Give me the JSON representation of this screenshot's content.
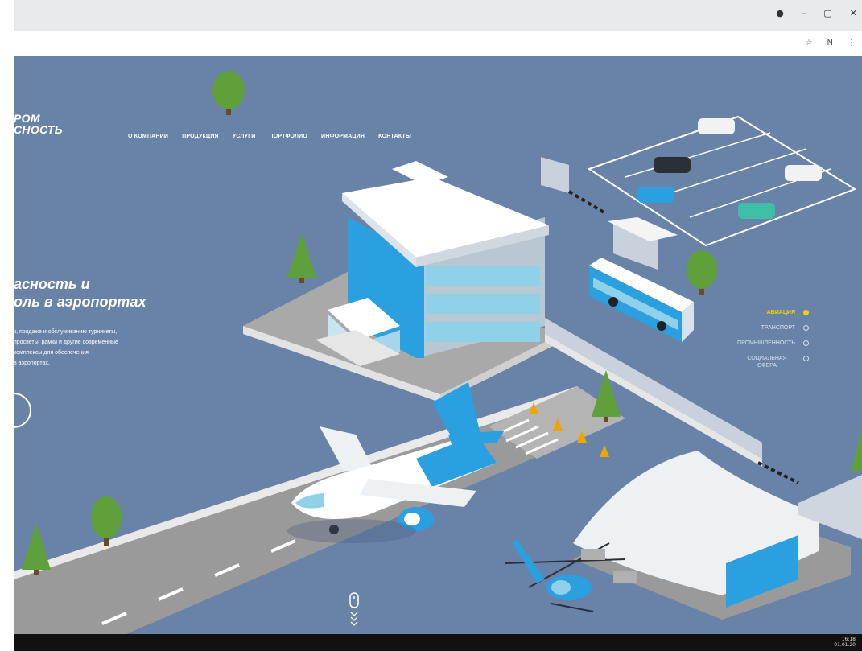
{
  "window": {
    "controls": [
      "●",
      "–",
      "▢",
      "✕"
    ],
    "addr_icons": [
      "☆",
      "N",
      "⋮"
    ]
  },
  "site": {
    "logo": [
      "РОМ",
      "СНОСТЬ"
    ],
    "nav": [
      "О компании",
      "Продукция",
      "Услуги",
      "Портфолио",
      "Информация",
      "Контакты"
    ],
    "hero": {
      "title": [
        "асность и",
        "оль в аэропортах"
      ],
      "desc": [
        "к, продаже и обслуживанию турникеты,",
        "просветы, рамки и другие современные",
        "комплексы для обеспечения",
        "в аэропортах."
      ]
    },
    "side_menu": [
      {
        "label": "Авиация",
        "active": true
      },
      {
        "label": "Транспорт",
        "active": false
      },
      {
        "label": "Промышленность",
        "active": false
      },
      {
        "label": "Социальная сфера",
        "active": false
      }
    ]
  },
  "taskbar": {
    "time": "16:18",
    "date": "01.01.20"
  },
  "colors": {
    "background": "#6983a8",
    "accent": "#f5d000",
    "brand_blue": "#2aa0e0"
  },
  "icons": {
    "scroll": "mouse-scroll-icon"
  }
}
